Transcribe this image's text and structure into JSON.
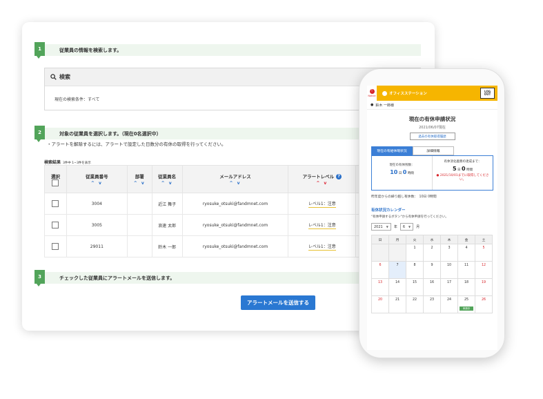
{
  "steps": [
    {
      "num": "1",
      "text": "従業員の情報を検索します。"
    },
    {
      "num": "2",
      "text": "対象の従業員を選択します。（現在0名選択中）"
    },
    {
      "num": "3",
      "text": "チェックした従業員にアラートメールを送信します。"
    }
  ],
  "search": {
    "title": "検索",
    "condition": "現在の検索条件：すべて",
    "icon": "search-icon"
  },
  "note": "・アラートを解除するには、アラートで設定した日数分の有休の取得を行ってください。",
  "results": {
    "label": "検索結果",
    "count": "3件中 1~3件を表示"
  },
  "table": {
    "headers": {
      "select": "選択",
      "emp_no": "従業員番号",
      "dept": "部署",
      "name": "従業員名",
      "email": "メールアドレス",
      "alert": "アラートレベル",
      "help": "?"
    },
    "sort": "^ v",
    "rows": [
      {
        "emp_no": "3004",
        "dept": "",
        "name": "近江 舞子",
        "email": "ryosuke_otsuki@fandmnet.com",
        "alert": "レベル1：注意"
      },
      {
        "emp_no": "3005",
        "dept": "",
        "name": "浪速 太郎",
        "email": "ryosuke_otsuki@fandmnet.com",
        "alert": "レベル1：注意"
      },
      {
        "emp_no": "29011",
        "dept": "",
        "name": "鈴木 一郎",
        "email": "ryosuke_otsuki@fandmnet.com",
        "alert": "レベル1：注意"
      }
    ]
  },
  "send_button": "アラートメールを送信する",
  "phone": {
    "app_name": "オフィスステーション",
    "badge_count": "!",
    "badge_label": "Notice",
    "logout": "LOG OUT",
    "user": "鈴木 一郎様",
    "title": "現在の有休申請状況",
    "date": "2021/06/07現在",
    "history_button": "過去の有休取得履歴",
    "tabs": [
      "現在の有給休暇状況",
      "詳細情報"
    ],
    "balance_label": "現在の有休残数：",
    "balance_days": "10",
    "balance_days_unit": "日",
    "balance_hours": "0",
    "balance_hours_unit": "時間",
    "required_label": "有休消化義務の達成まで：",
    "required_days": "5",
    "required_days_unit": "日",
    "required_hours": "0",
    "required_hours_unit": "時間",
    "warning": "2021/10/01までに取得してください。",
    "carryover": "昨年度からの繰り越し有休数：　10日 0時間",
    "calendar_title": "有休状況カレンダー",
    "calendar_sub": "\"有休申請するボタン\"から有休申請を行ってください。",
    "year": "2021",
    "year_unit": "年",
    "month": "6",
    "month_unit": "月",
    "weekdays": [
      "日",
      "月",
      "火",
      "水",
      "木",
      "金",
      "土"
    ],
    "weeks": [
      [
        "",
        "",
        "1",
        "2",
        "3",
        "4",
        "5"
      ],
      [
        "6",
        "7",
        "8",
        "9",
        "10",
        "11",
        "12"
      ],
      [
        "13",
        "14",
        "15",
        "16",
        "17",
        "18",
        "19"
      ],
      [
        "20",
        "21",
        "22",
        "23",
        "24",
        "25",
        "26"
      ]
    ],
    "applied_tag": "申請中",
    "colors": {
      "accent": "#f6b500",
      "primary": "#3b7fd6",
      "green": "#52a45a",
      "red": "#d8262b"
    }
  }
}
